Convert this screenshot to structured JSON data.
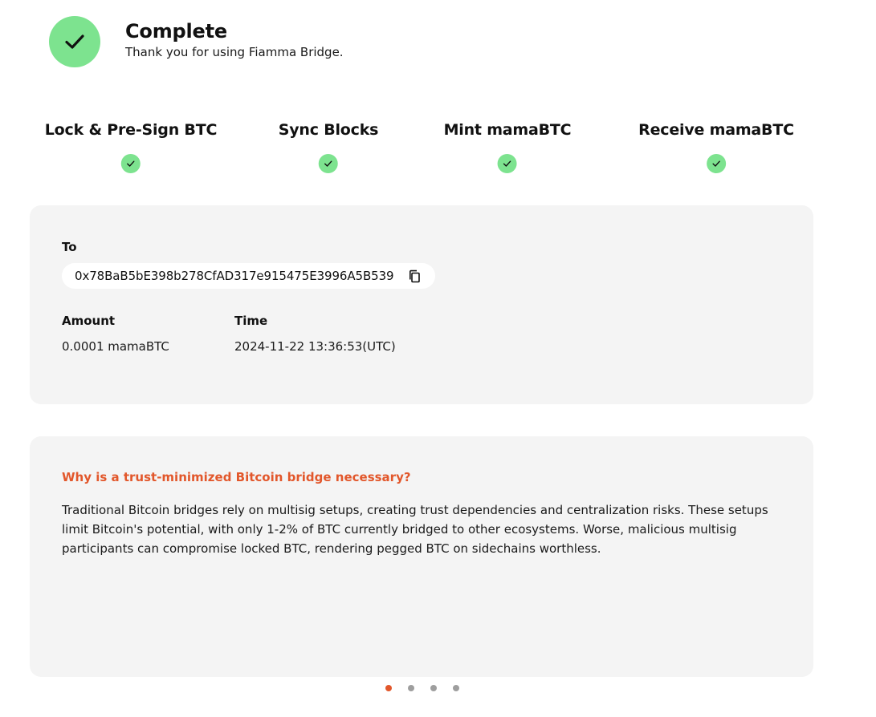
{
  "header": {
    "title": "Complete",
    "subtitle": "Thank you for using Fiamma Bridge.",
    "status_icon": "check-icon",
    "status_color": "#7de38f"
  },
  "steps": [
    {
      "label": "Lock & Pre-Sign BTC",
      "status": "done"
    },
    {
      "label": "Sync Blocks",
      "status": "done"
    },
    {
      "label": "Mint mamaBTC",
      "status": "done"
    },
    {
      "label": "Receive mamaBTC",
      "status": "done"
    }
  ],
  "details": {
    "to_label": "To",
    "to_address": "0x78BaB5bE398b278CfAD317e915475E3996A5B539",
    "copy_icon": "copy-icon",
    "amount_label": "Amount",
    "amount_value": "0.0001 mamaBTC",
    "time_label": "Time",
    "time_value": "2024-11-22 13:36:53(UTC)"
  },
  "faq": {
    "title": "Why is a trust-minimized Bitcoin bridge necessary?",
    "body": "Traditional Bitcoin bridges rely on multisig setups, creating trust dependencies and centralization risks. These setups limit Bitcoin's potential, with only 1-2% of BTC currently bridged to other ecosystems. Worse, malicious multisig participants can compromise locked BTC, rendering pegged BTC on sidechains worthless.",
    "accent_color": "#e2572b"
  },
  "pagination": {
    "count": 4,
    "active_index": 0,
    "active_color": "#e2572b",
    "inactive_color": "#9e9e9e"
  }
}
